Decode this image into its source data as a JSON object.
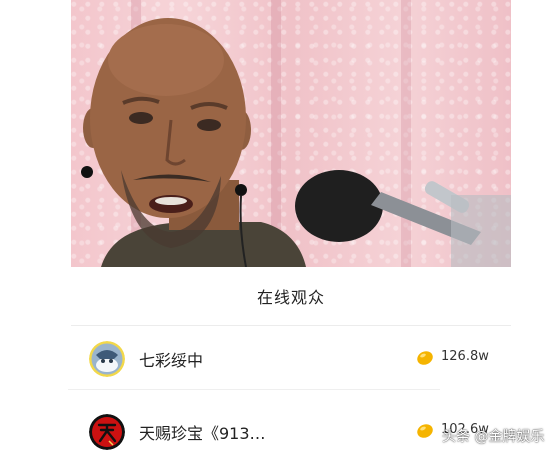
{
  "live_panel": {
    "title": "在线观众",
    "viewers": [
      {
        "name": "七彩绥中",
        "amount": "126.8w"
      },
      {
        "name": "天赐珍宝《913…",
        "amount": "102.6w"
      }
    ]
  },
  "watermark": {
    "text": "头条 @金牌娱乐"
  },
  "colors": {
    "coin": "#f5b400",
    "background": "#ffffff",
    "curtain": "#f3c6cc"
  },
  "icons": {
    "coin": "gold-coin-icon"
  }
}
